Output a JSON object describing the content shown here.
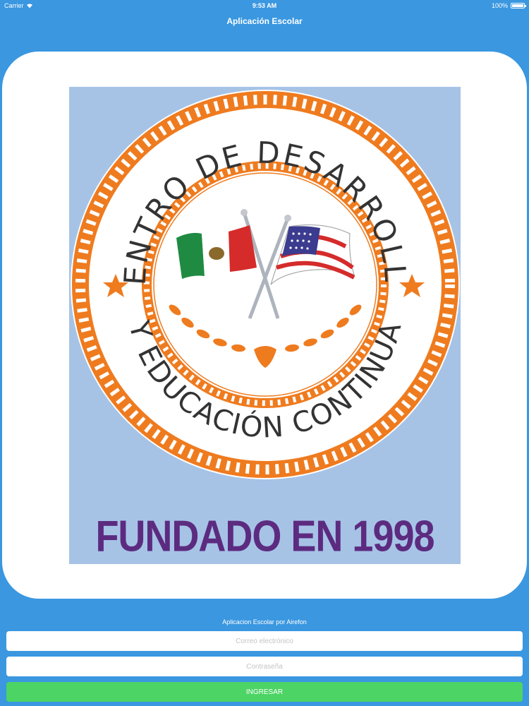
{
  "status_bar": {
    "carrier": "Carrier",
    "time": "9:53 AM",
    "battery": "100%"
  },
  "nav": {
    "title": "Aplicación Escolar"
  },
  "logo": {
    "ring_top_text": "CENTRO DE DESARROLLO",
    "ring_bottom_text": "Y EDUCACIÓN CONTINUA",
    "founded_text": "FUNDADO EN 1998"
  },
  "footer": {
    "caption": "Aplicacion Escolar por Airefon",
    "email_placeholder": "Correo electrónico",
    "password_placeholder": "Contraseña",
    "login_label": "INGRESAR"
  },
  "colors": {
    "background": "#3a97e0",
    "button": "#4cd465",
    "ring": "#ef7b1f",
    "founded_text": "#5c2b80"
  }
}
